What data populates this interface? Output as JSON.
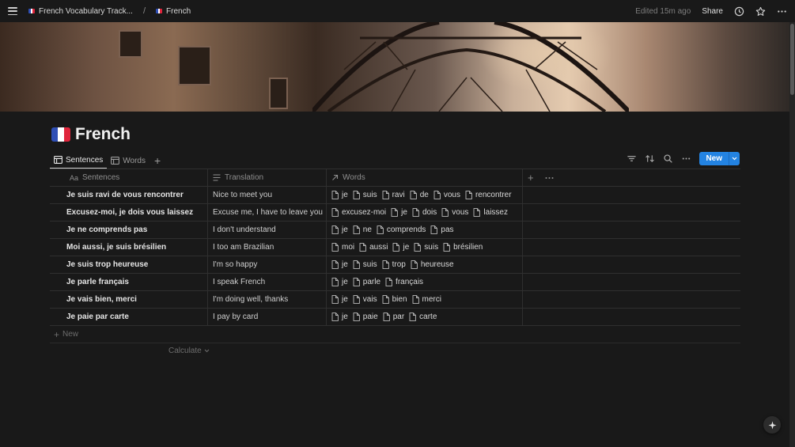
{
  "topbar": {
    "breadcrumb_parent": "French Vocabulary Track...",
    "breadcrumb_current": "French",
    "separator": "/",
    "edited": "Edited 15m ago",
    "share_label": "Share"
  },
  "page": {
    "title": "French",
    "icon": "french-flag-icon"
  },
  "views": {
    "tabs": [
      {
        "label": "Sentences",
        "icon": "table-icon",
        "active": true
      },
      {
        "label": "Words",
        "icon": "table-icon",
        "active": false
      }
    ],
    "new_label": "New"
  },
  "table": {
    "columns": [
      {
        "label": "Sentences",
        "icon_text": "Aa"
      },
      {
        "label": "Translation",
        "icon": "text-lines-icon"
      },
      {
        "label": "Words",
        "icon": "relation-arrow-icon"
      }
    ],
    "rows": [
      {
        "sentence": "Je suis ravi de vous rencontrer",
        "translation": "Nice to meet you",
        "words": [
          "je",
          "suis",
          "ravi",
          "de",
          "vous",
          "rencontrer"
        ]
      },
      {
        "sentence": "Excusez-moi, je dois vous laissez",
        "translation": "Excuse me, I have to leave you",
        "words": [
          "excusez-moi",
          "je",
          "dois",
          "vous",
          "laissez"
        ]
      },
      {
        "sentence": "Je ne comprends pas",
        "translation": "I don't understand",
        "words": [
          "je",
          "ne",
          "comprends",
          "pas"
        ]
      },
      {
        "sentence": "Moi aussi, je suis brésilien",
        "translation": "I too am Brazilian",
        "words": [
          "moi",
          "aussi",
          "je",
          "suis",
          "brésilien"
        ]
      },
      {
        "sentence": "Je suis trop heureuse",
        "translation": "I'm so happy",
        "words": [
          "je",
          "suis",
          "trop",
          "heureuse"
        ]
      },
      {
        "sentence": "Je parle français",
        "translation": "I speak French",
        "words": [
          "je",
          "parle",
          "français"
        ]
      },
      {
        "sentence": "Je vais bien, merci",
        "translation": "I'm doing well, thanks",
        "words": [
          "je",
          "vais",
          "bien",
          "merci"
        ]
      },
      {
        "sentence": "Je paie par carte",
        "translation": "I pay by card",
        "words": [
          "je",
          "paie",
          "par",
          "carte"
        ]
      }
    ],
    "new_row_label": "New",
    "calculate_label": "Calculate"
  },
  "colors": {
    "background": "#191919",
    "accent": "#2383e2",
    "flag_blue": "#2f4fb5",
    "flag_white": "#ffffff",
    "flag_red": "#e0253c"
  }
}
